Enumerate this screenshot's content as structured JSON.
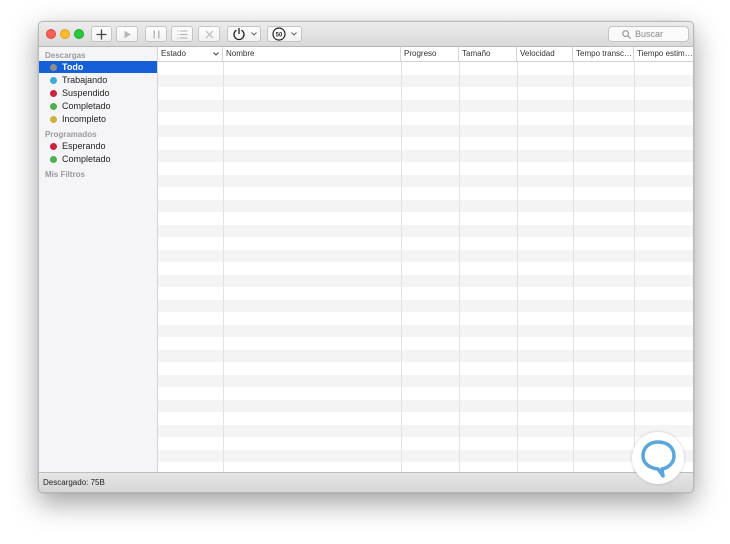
{
  "toolbar": {
    "buttons": [
      "add-download",
      "resume",
      "pause",
      "list-view",
      "cancel",
      "power",
      "speed-limit"
    ],
    "speed_badge": "50",
    "search_placeholder": "Buscar"
  },
  "sidebar": {
    "sections": [
      {
        "title": "Descargas",
        "items": [
          {
            "label": "Todo",
            "color": "#8e8e8e",
            "selected": true
          },
          {
            "label": "Trabajando",
            "color": "#3fa9dc"
          },
          {
            "label": "Suspendido",
            "color": "#c8253f"
          },
          {
            "label": "Completado",
            "color": "#4caf50"
          },
          {
            "label": "Incompleto",
            "color": "#c9b33b"
          }
        ]
      },
      {
        "title": "Programados",
        "items": [
          {
            "label": "Esperando",
            "color": "#c8253f"
          },
          {
            "label": "Completado",
            "color": "#4caf50"
          }
        ]
      },
      {
        "title": "Mis Filtros",
        "items": []
      }
    ]
  },
  "table": {
    "columns": [
      "Estado",
      "Nombre",
      "Progreso",
      "Tamaño",
      "Velocidad",
      "Tempo transc…",
      "Tiempo estim…"
    ],
    "sort_indicator": "chevron-down",
    "rows": []
  },
  "status": {
    "text": "Descargado: 75B"
  },
  "colors": {
    "selection": "#1560d6",
    "logo": "#5aa5dc"
  }
}
